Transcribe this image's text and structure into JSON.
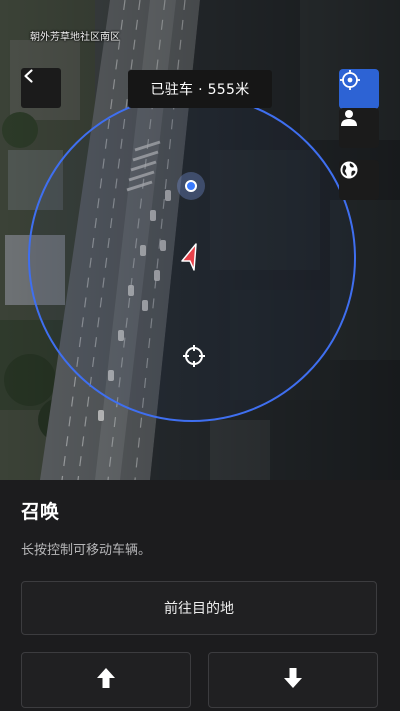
{
  "map": {
    "area_label": "朝外芳草地社区南区",
    "status": "已驻车 · 555米",
    "icons": {
      "back": "chevron-left-icon",
      "locate": "crosshair-icon",
      "person": "person-icon",
      "globe": "globe-icon",
      "car": "navigation-arrow-icon",
      "target": "crosshair-target-icon",
      "user_location": "location-dot-icon"
    },
    "colors": {
      "accent": "#2d63d4",
      "range_circle": "#3f6ff0",
      "car_marker": "#e8414a"
    }
  },
  "panel": {
    "title": "召唤",
    "description": "长按控制可移动车辆。",
    "destination_button": "前往目的地",
    "forward_icon": "arrow-up-icon",
    "reverse_icon": "arrow-down-icon"
  }
}
